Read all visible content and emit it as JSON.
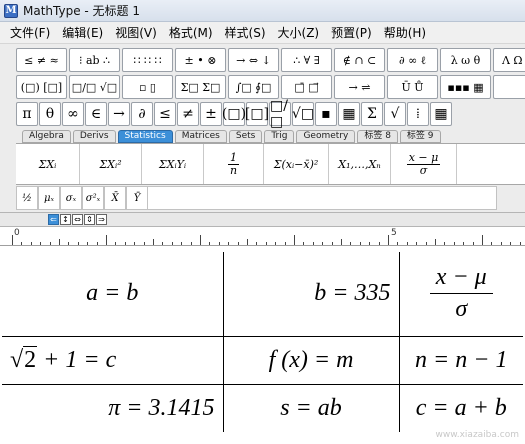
{
  "titlebar": {
    "title": "MathType - 无标题 1",
    "icon_letter": "M"
  },
  "menu": [
    "文件(F)",
    "编辑(E)",
    "视图(V)",
    "格式(M)",
    "样式(S)",
    "大小(Z)",
    "预置(P)",
    "帮助(H)"
  ],
  "palette_row1": [
    "≤ ≠ ≈",
    "⁝ ab ∴",
    "∷ ∷ ∷",
    "± • ⊗",
    "→ ⇔ ↓",
    "∴ ∀ ∃",
    "∉ ∩ ⊂",
    "∂ ∞ ℓ",
    "λ ω θ",
    "Λ Ω Θ"
  ],
  "palette_row2": [
    "(□) [□]",
    "□/□ √□",
    "▫ ▯",
    "Σ□ Σ□",
    "∫□ ∮□",
    "□̄ □⃗",
    "→ ⇌",
    "Ū Ů",
    "▪▪▪ ▦",
    ""
  ],
  "symbol_row": [
    "π",
    "θ",
    "∞",
    "∈",
    "→",
    "∂",
    "≤",
    "≠",
    "±",
    "(□)",
    "[□]",
    "□/□",
    "√□",
    "▪",
    "▦",
    "Σ",
    "√",
    "⁞",
    "▦"
  ],
  "tabs": [
    "Algebra",
    "Derivs",
    "Statistics",
    "Matrices",
    "Sets",
    "Trig",
    "Geometry",
    "标签 8",
    "标签 9"
  ],
  "active_tab": "Statistics",
  "templates": [
    "ΣXᵢ",
    "ΣXᵢ²",
    "ΣXᵢYᵢ",
    "1/n",
    "Σ(xᵢ−x̄)²",
    "X₁,…,Xₙ",
    "(x−μ)/σ"
  ],
  "template_frac_1n": {
    "num": "1",
    "den": "n"
  },
  "template_frac_z": {
    "num": "x − μ",
    "den": "σ"
  },
  "small_templates": [
    "½",
    "μₓ",
    "σₓ",
    "σ²ₓ",
    "X̄",
    "Ȳ"
  ],
  "align_buttons": [
    "⇐",
    "↕",
    "⇔",
    "⇕",
    "⇒"
  ],
  "ruler": {
    "mark_0": "0",
    "mark_5": "5"
  },
  "document": {
    "r1c1": "a = b",
    "r1c2": "b = 335",
    "r1c3_num": "x − μ",
    "r1c3_den": "σ",
    "r2c1_radicand": "2",
    "r2c1_rest": " + 1 = c",
    "r2c2": "f (x) = m",
    "r2c3": "n = n − 1",
    "r3c1": "π = 3.1415",
    "r3c2": "s = ab",
    "r3c3": "c = a + b"
  },
  "watermark": "www.xiazaiba.com"
}
